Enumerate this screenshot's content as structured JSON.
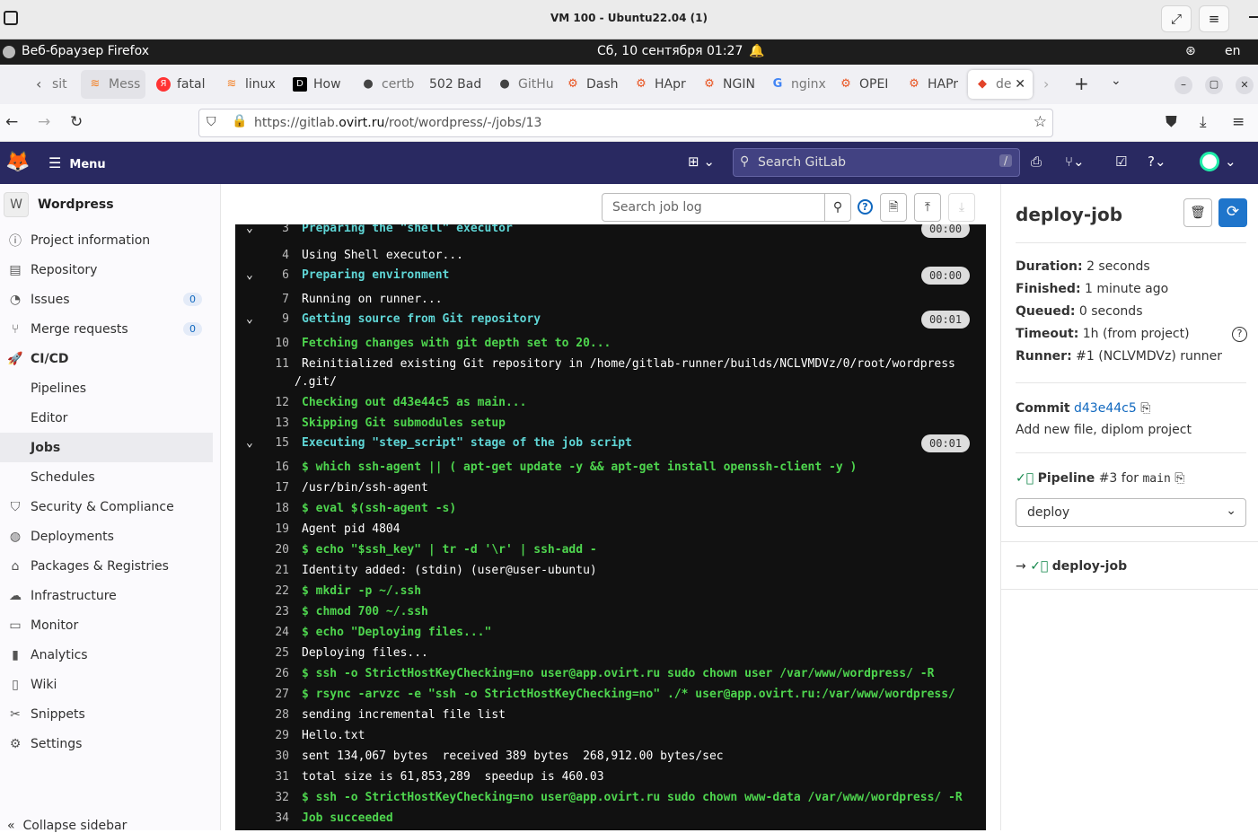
{
  "vm": {
    "title": "VM 100 - Ubuntu22.04 (1)"
  },
  "ubuntu_panel": {
    "app": "Веб-браузер Firefox",
    "datetime": "Сб, 10 сентября  01:27",
    "lang": "en"
  },
  "tabs": [
    {
      "label": "sit",
      "icon": "gitlab-icon"
    },
    {
      "label": "Mess",
      "icon": "stack-icon"
    },
    {
      "label": "fatal",
      "icon": "yandex-icon"
    },
    {
      "label": "linux",
      "icon": "stack-icon"
    },
    {
      "label": "How",
      "icon": "dev-icon"
    },
    {
      "label": "certb",
      "icon": "github-icon"
    },
    {
      "label": "502 Bad",
      "icon": "none"
    },
    {
      "label": "GitHu",
      "icon": "github-icon"
    },
    {
      "label": "Dash",
      "icon": "gear-icon"
    },
    {
      "label": "HApr",
      "icon": "gear-icon"
    },
    {
      "label": "NGIN",
      "icon": "gear-icon"
    },
    {
      "label": "nginx",
      "icon": "google-icon"
    },
    {
      "label": "OPEI",
      "icon": "gear-icon"
    },
    {
      "label": "HAPr",
      "icon": "gear-icon"
    },
    {
      "label": "de",
      "icon": "gitlab-icon"
    }
  ],
  "url": {
    "prefix": "https://gitlab.",
    "domain": "ovirt.ru",
    "path": "/root/wordpress/-/jobs/13"
  },
  "gitlab_header": {
    "menu": "Menu",
    "search_placeholder": "Search GitLab",
    "search_key": "/"
  },
  "sidebar": {
    "project_initial": "W",
    "project_name": "Wordpress",
    "items": [
      {
        "label": "Project information",
        "icon": "info-icon"
      },
      {
        "label": "Repository",
        "icon": "doc-icon"
      },
      {
        "label": "Issues",
        "icon": "issues-icon",
        "badge": "0"
      },
      {
        "label": "Merge requests",
        "icon": "merge-icon",
        "badge": "0"
      },
      {
        "label": "CI/CD",
        "icon": "rocket-icon"
      },
      {
        "label": "Pipelines",
        "sub": true
      },
      {
        "label": "Editor",
        "sub": true
      },
      {
        "label": "Jobs",
        "sub": true,
        "active": true
      },
      {
        "label": "Schedules",
        "sub": true
      },
      {
        "label": "Security & Compliance",
        "icon": "shield-icon"
      },
      {
        "label": "Deployments",
        "icon": "deploy-icon"
      },
      {
        "label": "Packages & Registries",
        "icon": "package-icon"
      },
      {
        "label": "Infrastructure",
        "icon": "cloud-icon"
      },
      {
        "label": "Monitor",
        "icon": "monitor-icon"
      },
      {
        "label": "Analytics",
        "icon": "chart-icon"
      },
      {
        "label": "Wiki",
        "icon": "book-icon"
      },
      {
        "label": "Snippets",
        "icon": "scissors-icon"
      },
      {
        "label": "Settings",
        "icon": "settings-icon"
      }
    ],
    "collapse": "Collapse sidebar"
  },
  "log_toolbar": {
    "search_placeholder": "Search job log"
  },
  "log": [
    {
      "n": "3",
      "t": "Preparing the \"shell\" executor",
      "cls": "c",
      "section": true,
      "dur": "00:00"
    },
    {
      "n": "4",
      "t": "Using Shell executor...",
      "cls": ""
    },
    {
      "n": "6",
      "t": "Preparing environment",
      "cls": "c",
      "section": true,
      "dur": "00:00"
    },
    {
      "n": "7",
      "t": "Running on runner...",
      "cls": ""
    },
    {
      "n": "9",
      "t": "Getting source from Git repository",
      "cls": "c",
      "section": true,
      "dur": "00:01"
    },
    {
      "n": "10",
      "t": "Fetching changes with git depth set to 20...",
      "cls": "g"
    },
    {
      "n": "11",
      "t": "Reinitialized existing Git repository in /home/gitlab-runner/builds/NCLVMDVz/0/root/wordpress",
      "cls": ""
    },
    {
      "n": "",
      "t": "/.git/",
      "cls": "",
      "cont": true
    },
    {
      "n": "12",
      "t": "Checking out d43e44c5 as main...",
      "cls": "g"
    },
    {
      "n": "13",
      "t": "Skipping Git submodules setup",
      "cls": "g"
    },
    {
      "n": "15",
      "t": "Executing \"step_script\" stage of the job script",
      "cls": "c",
      "section": true,
      "dur": "00:01"
    },
    {
      "n": "16",
      "t": "$ which ssh-agent || ( apt-get update -y && apt-get install openssh-client -y )",
      "cls": "g"
    },
    {
      "n": "17",
      "t": "/usr/bin/ssh-agent",
      "cls": ""
    },
    {
      "n": "18",
      "t": "$ eval $(ssh-agent -s)",
      "cls": "g"
    },
    {
      "n": "19",
      "t": "Agent pid 4804",
      "cls": ""
    },
    {
      "n": "20",
      "t": "$ echo \"$ssh_key\" | tr -d '\\r' | ssh-add -",
      "cls": "g"
    },
    {
      "n": "21",
      "t": "Identity added: (stdin) (user@user-ubuntu)",
      "cls": ""
    },
    {
      "n": "22",
      "t": "$ mkdir -p ~/.ssh",
      "cls": "g"
    },
    {
      "n": "23",
      "t": "$ chmod 700 ~/.ssh",
      "cls": "g"
    },
    {
      "n": "24",
      "t": "$ echo \"Deploying files...\"",
      "cls": "g"
    },
    {
      "n": "25",
      "t": "Deploying files...",
      "cls": ""
    },
    {
      "n": "26",
      "t": "$ ssh -o StrictHostKeyChecking=no user@app.ovirt.ru sudo chown user /var/www/wordpress/ -R",
      "cls": "g"
    },
    {
      "n": "27",
      "t": "$ rsync -arvzc -e \"ssh -o StrictHostKeyChecking=no\" ./* user@app.ovirt.ru:/var/www/wordpress/",
      "cls": "g"
    },
    {
      "n": "28",
      "t": "sending incremental file list",
      "cls": ""
    },
    {
      "n": "29",
      "t": "Hello.txt",
      "cls": ""
    },
    {
      "n": "30",
      "t": "sent 134,067 bytes  received 389 bytes  268,912.00 bytes/sec",
      "cls": ""
    },
    {
      "n": "31",
      "t": "total size is 61,853,289  speedup is 460.03",
      "cls": ""
    },
    {
      "n": "32",
      "t": "$ ssh -o StrictHostKeyChecking=no user@app.ovirt.ru sudo chown www-data /var/www/wordpress/ -R",
      "cls": "g"
    },
    {
      "n": "34",
      "t": "Job succeeded",
      "cls": "g"
    }
  ],
  "job": {
    "title": "deploy-job",
    "duration_label": "Duration:",
    "duration": "2 seconds",
    "finished_label": "Finished:",
    "finished": "1 minute ago",
    "queued_label": "Queued:",
    "queued": "0 seconds",
    "timeout_label": "Timeout:",
    "timeout": "1h (from project)",
    "runner_label": "Runner:",
    "runner": "#1 (NCLVMDVz) runner",
    "commit_label": "Commit",
    "commit": "d43e44c5",
    "commit_msg": "Add new file, diplom project",
    "pipeline_label": "Pipeline",
    "pipeline": "#3 for",
    "branch": "main",
    "stage": "deploy",
    "job_link": "deploy-job"
  },
  "colors": {
    "gitlab_header": "#292961",
    "link": "#1068bf",
    "success": "#108548",
    "log_green": "#4ed54e",
    "log_cyan": "#5fd6d6"
  }
}
